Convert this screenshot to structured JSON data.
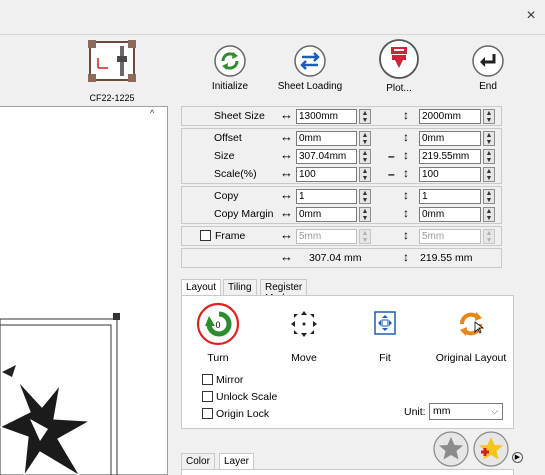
{
  "window": {
    "close_glyph": "×"
  },
  "device": {
    "name": "CF22-1225",
    "icon": "cutting-plotter-icon"
  },
  "toolbar": {
    "initialize": "Initialize",
    "sheet_loading": "Sheet Loading",
    "plot": "Plot...",
    "end": "End"
  },
  "settings": {
    "sheet_size": {
      "label": "Sheet Size",
      "width": "1300mm",
      "height": "2000mm"
    },
    "offset": {
      "label": "Offset",
      "x": "0mm",
      "y": "0mm"
    },
    "size": {
      "label": "Size",
      "width": "307.04mm",
      "height": "219.55mm"
    },
    "scale": {
      "label": "Scale(%)",
      "x": "100",
      "y": "100"
    },
    "copy": {
      "label": "Copy",
      "x": "1",
      "y": "1"
    },
    "copy_margin": {
      "label": "Copy Margin",
      "x": "0mm",
      "y": "0mm"
    },
    "frame": {
      "label": "Frame",
      "x": "5mm",
      "y": "5mm",
      "checked": false
    },
    "totals": {
      "width": "307.04 mm",
      "height": "219.55 mm"
    },
    "arrow_h": "↔",
    "arrow_v": "↕",
    "link": "–"
  },
  "tabs": {
    "items": [
      {
        "label": "Layout",
        "active": true
      },
      {
        "label": "Tiling",
        "active": false
      },
      {
        "label": "Register Mark",
        "active": false
      }
    ]
  },
  "layout_tools": {
    "turn": {
      "label": "Turn",
      "badge": "0"
    },
    "move": {
      "label": "Move"
    },
    "fit": {
      "label": "Fit"
    },
    "original_layout": {
      "label": "Original Layout"
    }
  },
  "options": {
    "mirror": "Mirror",
    "unlock_scale": "Unlock Scale",
    "origin_lock": "Origin Lock",
    "unit_label": "Unit:",
    "unit_value": "mm"
  },
  "bottom_tabs": [
    {
      "label": "Color",
      "active": false
    },
    {
      "label": "Layer",
      "active": true
    }
  ],
  "colors": {
    "accent_green": "#2e8b2e",
    "plot_red": "#d6213a",
    "highlight_circle": "#e0201e",
    "arrow_blue": "#1a5fb4",
    "orange": "#e8861a"
  }
}
